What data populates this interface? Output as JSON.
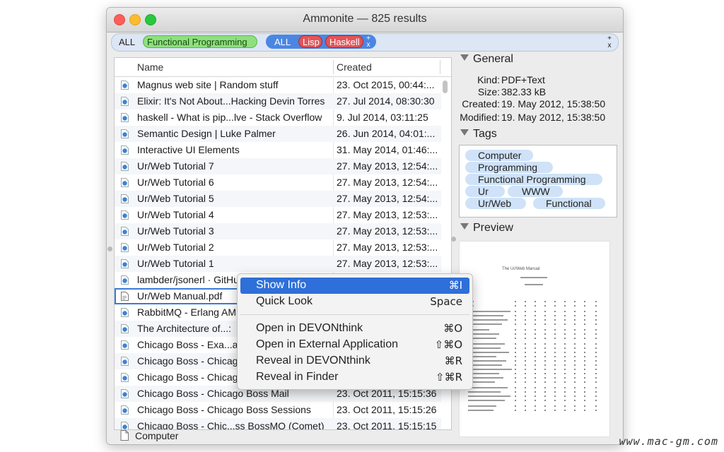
{
  "window": {
    "title": "Ammonite — 825 results"
  },
  "query": {
    "all_label": "ALL",
    "tag_functional": "Functional Programming",
    "group_all_label": "ALL",
    "tag_lisp": "Lisp",
    "tag_haskell": "Haskell",
    "plus": "+",
    "x": "x"
  },
  "list": {
    "columns": {
      "name": "Name",
      "created": "Created"
    },
    "rows": [
      {
        "name": "Magnus web site | Random stuff",
        "created": "23. Oct 2015, 00:44:..."
      },
      {
        "name": "Elixir: It's Not About...Hacking Devin Torres",
        "created": "27. Jul 2014, 08:30:30"
      },
      {
        "name": "haskell - What is pip...lve - Stack Overflow",
        "created": "9. Jul 2014, 03:11:25"
      },
      {
        "name": "Semantic Design | Luke Palmer",
        "created": "26. Jun 2014, 04:01:..."
      },
      {
        "name": "Interactive UI Elements",
        "created": "31. May 2014, 01:46:..."
      },
      {
        "name": "Ur/Web Tutorial 7",
        "created": "27. May 2013, 12:54:..."
      },
      {
        "name": "Ur/Web Tutorial 6",
        "created": "27. May 2013, 12:54:..."
      },
      {
        "name": "Ur/Web Tutorial 5",
        "created": "27. May 2013, 12:54:..."
      },
      {
        "name": "Ur/Web Tutorial 4",
        "created": "27. May 2013, 12:53:..."
      },
      {
        "name": "Ur/Web Tutorial 3",
        "created": "27. May 2013, 12:53:..."
      },
      {
        "name": "Ur/Web Tutorial 2",
        "created": "27. May 2013, 12:53:..."
      },
      {
        "name": "Ur/Web Tutorial 1",
        "created": "27. May 2013, 12:53:..."
      },
      {
        "name": "lambder/jsonerl · GitHu",
        "created": ""
      },
      {
        "name": "Ur/Web Manual.pdf",
        "created": ""
      },
      {
        "name": "RabbitMQ - Erlang AM",
        "created": ""
      },
      {
        "name": "The Architecture of...:",
        "created": ""
      },
      {
        "name": "Chicago Boss - Exa...ative",
        "created": ""
      },
      {
        "name": "Chicago Boss - Chicag",
        "created": ""
      },
      {
        "name": "Chicago Boss - Chicag",
        "created": ""
      },
      {
        "name": "Chicago Boss - Chicago Boss Mail",
        "created": "23. Oct 2011, 15:15:36"
      },
      {
        "name": "Chicago Boss - Chicago Boss Sessions",
        "created": "23. Oct 2011, 15:15:26"
      },
      {
        "name": "Chicago Boss - Chic...ss BossMQ (Comet)",
        "created": "23. Oct 2011, 15:15:15"
      }
    ]
  },
  "status": {
    "location": "Computer"
  },
  "inspector": {
    "general": {
      "heading": "General",
      "fields": [
        {
          "key": "Kind:",
          "value": "PDF+Text"
        },
        {
          "key": "Size:",
          "value": "382.33 kB"
        },
        {
          "key": "Created:",
          "value": "19. May 2012, 15:38:50"
        },
        {
          "key": "Modified:",
          "value": "19. May 2012, 15:38:50"
        }
      ]
    },
    "tags": {
      "heading": "Tags",
      "items": [
        "Computer",
        "Programming",
        "Functional Programming",
        "Ur",
        "WWW",
        "Ur/Web",
        "Functional"
      ]
    },
    "preview": {
      "heading": "Preview",
      "doc_title": "The Ur/Web Manual"
    }
  },
  "context_menu": {
    "items": [
      {
        "label": "Show Info",
        "shortcut": "⌘I"
      },
      {
        "label": "Quick Look",
        "shortcut": "Space"
      },
      {
        "label": "Open in DEVONthink",
        "shortcut": "⌘O"
      },
      {
        "label": "Open in External Application",
        "shortcut": "⇧⌘O"
      },
      {
        "label": "Reveal in DEVONthink",
        "shortcut": "⌘R"
      },
      {
        "label": "Reveal in Finder",
        "shortcut": "⇧⌘R"
      }
    ]
  },
  "watermark": "www.mac-gm.com",
  "colors": {
    "accent": "#2e6fd9",
    "tag_green": "#8ee07d",
    "tag_red": "#e0555a",
    "tag_blue": "#cfe2f7"
  }
}
